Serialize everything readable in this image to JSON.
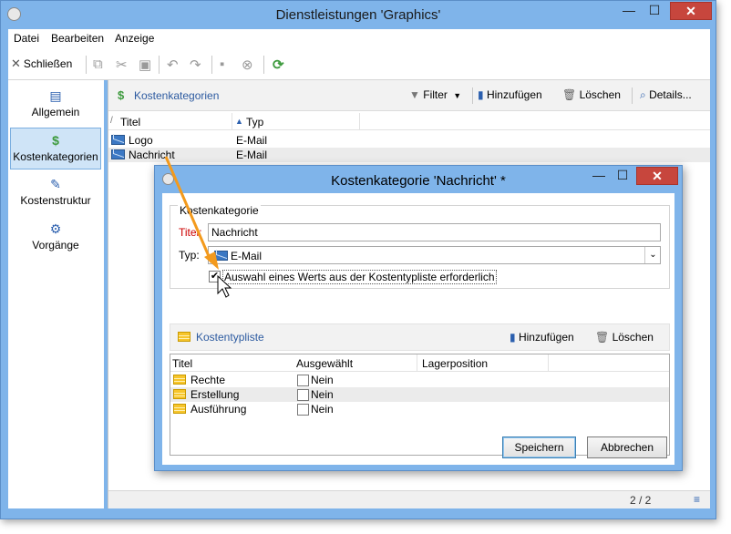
{
  "window": {
    "title": "Dienstleistungen 'Graphics'",
    "minimize": "—",
    "maximize": "☐",
    "close": "✕"
  },
  "menu": [
    "Datei",
    "Bearbeiten",
    "Anzeige"
  ],
  "toolbar": {
    "close_label": "Schließen",
    "close_glyph": "✕"
  },
  "sidebar": {
    "items": [
      {
        "label": "Allgemein",
        "icon": "clipboard-icon",
        "glyph": "▤",
        "color": "#2b5fae",
        "selected": false
      },
      {
        "label": "Kostenkategorien",
        "icon": "dollar-coin-icon",
        "glyph": "$",
        "color": "#3d9a3d",
        "selected": true
      },
      {
        "label": "Kostenstruktur",
        "icon": "edit-document-icon",
        "glyph": "✎",
        "color": "#2b5fae",
        "selected": false
      },
      {
        "label": "Vorgänge",
        "icon": "gears-icon",
        "glyph": "⚙",
        "color": "#2b5fae",
        "selected": false
      }
    ]
  },
  "pane": {
    "title": "Kostenkategorien",
    "filter_label": "Filter",
    "add_label": "Hinzufügen",
    "delete_label": "Löschen",
    "details_label": "Details..."
  },
  "grid": {
    "columns": [
      "Titel",
      "Typ"
    ],
    "sort_marker": "/",
    "sort_arrow": "▲",
    "rows": [
      {
        "title": "Logo",
        "type": "E-Mail"
      },
      {
        "title": "Nachricht",
        "type": "E-Mail"
      }
    ],
    "page_info": "2 / 2"
  },
  "dialog": {
    "title": "Kostenkategorie 'Nachricht' *",
    "group_label": "Kostenkategorie",
    "title_field_label": "Titel:",
    "title_field_value": "Nachricht",
    "type_field_label": "Typ:",
    "type_field_value": "E-Mail",
    "checkbox_label": "Auswahl eines Werts aus der Kostentypliste erforderlich",
    "checkbox_checked": true,
    "list_title": "Kostentypliste",
    "list_add_label": "Hinzufügen",
    "list_delete_label": "Löschen",
    "list_columns": [
      "Titel",
      "Ausgewählt",
      "Lagerposition"
    ],
    "list_rows": [
      {
        "title": "Rechte",
        "selected": "Nein"
      },
      {
        "title": "Erstellung",
        "selected": "Nein"
      },
      {
        "title": "Ausführung",
        "selected": "Nein"
      }
    ],
    "save_label": "Speichern",
    "cancel_label": "Abbrechen"
  },
  "colors": {
    "frame": "#7fb4ea",
    "close_button": "#c7463d",
    "link_blue": "#2c5aa0",
    "required_red": "#cc0000",
    "annotation_arrow": "#f39a1d"
  }
}
